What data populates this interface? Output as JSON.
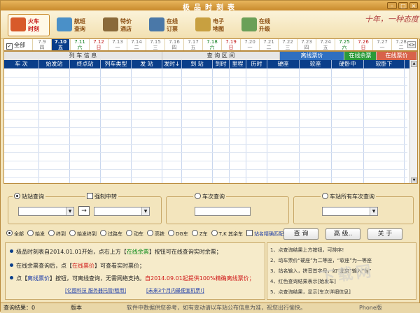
{
  "window": {
    "title": "极品时刻表"
  },
  "toolbar": [
    {
      "label": "火车\n时刻",
      "color": "#d85a2a"
    },
    {
      "label": "航班\n查询",
      "color": "#4a90c8"
    },
    {
      "label": "特价\n酒店",
      "color": "#8a6a3a"
    },
    {
      "label": "在线\n订票",
      "color": "#4a78a8"
    },
    {
      "label": "电子\n地图",
      "color": "#c8a040"
    },
    {
      "label": "在线\n升级",
      "color": "#6aa058"
    }
  ],
  "signature": "十年，一种态度",
  "date_bar": {
    "all_label": "全部",
    "dates": [
      {
        "d": "7.9",
        "w": "四",
        "k": "normal"
      },
      {
        "d": "7.10",
        "w": "五",
        "k": "selected"
      },
      {
        "d": "7.11",
        "w": "六",
        "k": "sat"
      },
      {
        "d": "7.12",
        "w": "日",
        "k": "sun"
      },
      {
        "d": "7.13",
        "w": "一",
        "k": "normal"
      },
      {
        "d": "7.14",
        "w": "二",
        "k": "normal"
      },
      {
        "d": "7.15",
        "w": "三",
        "k": "normal"
      },
      {
        "d": "7.16",
        "w": "四",
        "k": "normal"
      },
      {
        "d": "7.17",
        "w": "五",
        "k": "normal"
      },
      {
        "d": "7.18",
        "w": "六",
        "k": "sat"
      },
      {
        "d": "7.19",
        "w": "日",
        "k": "sun"
      },
      {
        "d": "7.20",
        "w": "一",
        "k": "normal"
      },
      {
        "d": "7.21",
        "w": "二",
        "k": "normal"
      },
      {
        "d": "7.22",
        "w": "三",
        "k": "normal"
      },
      {
        "d": "7.23",
        "w": "四",
        "k": "normal"
      },
      {
        "d": "7.24",
        "w": "五",
        "k": "normal"
      },
      {
        "d": "7.25",
        "w": "六",
        "k": "sat"
      },
      {
        "d": "7.26",
        "w": "日",
        "k": "sun"
      },
      {
        "d": "7.27",
        "w": "一",
        "k": "normal"
      },
      {
        "d": "7.28",
        "w": "二",
        "k": "normal"
      }
    ]
  },
  "grid": {
    "group_headers": {
      "train_info": "列 车 信 息",
      "query_range": "查 询 区 间",
      "offline_price": "离线票价",
      "online_tickets": "在线余票",
      "online_price": "在线票价"
    },
    "columns": [
      "车 次",
      "始发站",
      "终点站",
      "列车类型",
      "发 站",
      "发时↓",
      "到 站",
      "到时",
      "里程",
      "历时",
      "硬座",
      "软座",
      "硬卧中",
      "软卧下"
    ]
  },
  "station_panel": {
    "legend": "站站查询",
    "transfer": "强制中转",
    "arrow": "→"
  },
  "train_panel": {
    "legend": "车次查询"
  },
  "allstation_panel": {
    "legend": "车站所有车次查询"
  },
  "filters": {
    "items": [
      "全部",
      "始发",
      "终到",
      "始发终到",
      "过路车",
      "动车",
      "高铁",
      "DG车",
      "Z车",
      "T,K 其余车"
    ],
    "exact_match": "站名精确匹配"
  },
  "buttons": {
    "query": "查 询",
    "advanced": "高 级..",
    "about": "关 于"
  },
  "notes": {
    "line1_a": "极品时刻表自2014.01.01开始，点右上方【",
    "line1_b": "在线余票",
    "line1_c": "】按钮可在线查询实时余票；",
    "line2_a": "在线余票查询后，点【",
    "line2_b": "在线票价",
    "line2_c": "】可查看实时票价；",
    "line3_a": "点【",
    "line3_b": "离线票价",
    "line3_c": "】按钮，可离线查询，无需网络支持。",
    "line3_d": "自2014.09.01起提供100%精确离线票价；",
    "link1": "[亿图科技 服务器托管/租用]",
    "link2": "[未来3个月内最便宜机票!]"
  },
  "tips": [
    "1、点查询结果上方按钮，可排序!",
    "2、动车票价“硬座”为二等座，“软座”为一等座",
    "3、站名输入，拼音首字母，如“北京”输入“bj”",
    "4、红色查询结果表示[始发车]",
    "5、点查询结果，显示[车次详细信息]"
  ],
  "status": {
    "results": "查询结果：0",
    "version": "版本",
    "disclaimer": "软件中数据供您参考，如有变动请以车站公布信息为准，祝您出行愉快。",
    "phone": "Phone版"
  },
  "watermark": "下载网"
}
